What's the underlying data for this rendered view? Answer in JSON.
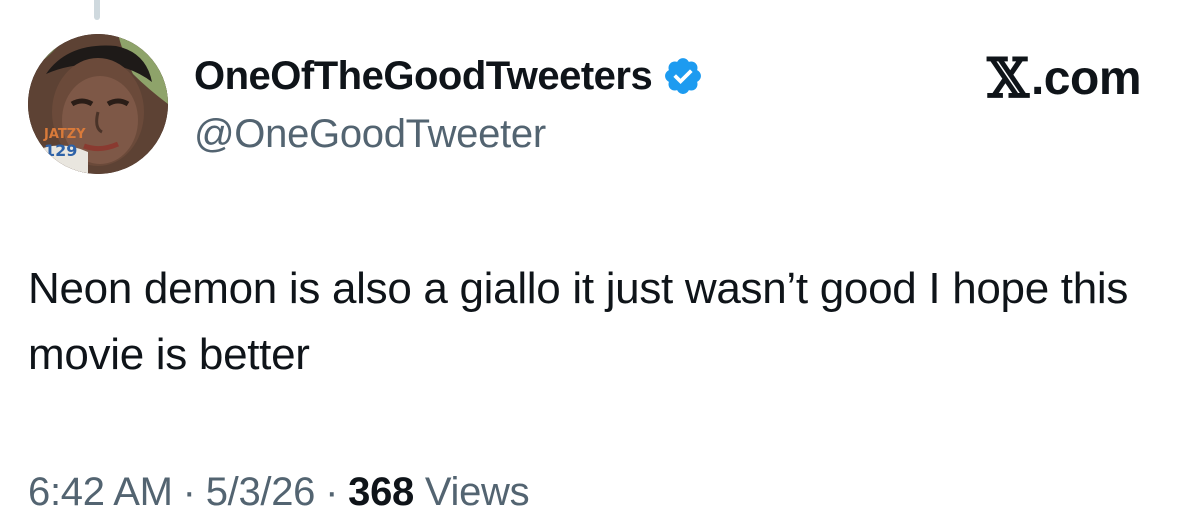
{
  "tweet": {
    "display_name": "OneOfTheGoodTweeters",
    "handle": "@OneGoodTweeter",
    "verified": true,
    "brand": {
      "mark": "𝕏",
      "text": ".com"
    },
    "text": "Neon demon is also a giallo it just wasn’t good I hope this movie is better",
    "time": "6:42 AM",
    "date": "5/3/26",
    "separator": "·",
    "views_count": "368",
    "views_label": "Views",
    "avatar_jersey_text": "JATZY",
    "avatar_jersey_number": "129"
  },
  "colors": {
    "verified_blue": "#1d9bf0",
    "text_primary": "#0f1419",
    "text_secondary": "#536471"
  },
  "icons": {
    "verified": "verified-badge-icon",
    "brand": "x-logo-icon"
  }
}
